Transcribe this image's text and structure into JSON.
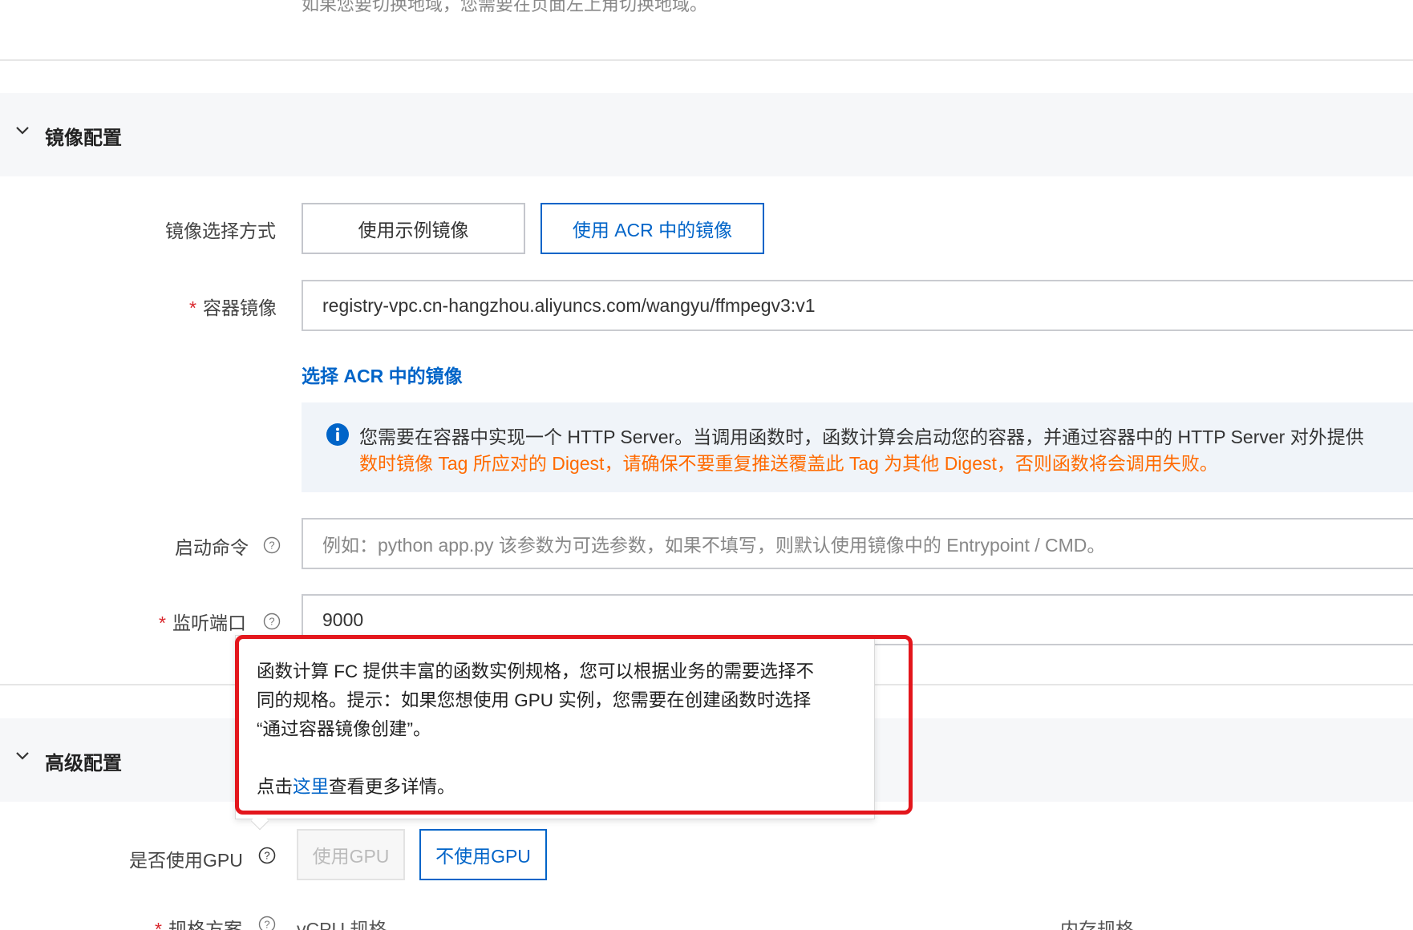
{
  "top_hint": "如果您要切换地域，您需要在页面左上角切换地域。",
  "image_section": {
    "title": "镜像配置",
    "select_method_label": "镜像选择方式",
    "method_options": [
      "使用示例镜像",
      "使用 ACR 中的镜像"
    ],
    "selected_method": "使用 ACR 中的镜像",
    "container_image_label": "容器镜像",
    "container_image_value": "registry-vpc.cn-hangzhou.aliyuncs.com/wangyu/ffmpegv3:v1",
    "select_acr_link": "选择 ACR 中的镜像",
    "alert_line1": "您需要在容器中实现一个 HTTP Server。当调用函数时，函数计算会启动您的容器，并通过容器中的 HTTP Server 对外提供",
    "alert_line2": "数时镜像 Tag 所应对的 Digest，请确保不要重复推送覆盖此 Tag 为其他 Digest，否则函数将会调用失败。",
    "startup_cmd_label": "启动命令",
    "startup_cmd_placeholder": "例如：python app.py 该参数为可选参数，如果不填写，则默认使用镜像中的 Entrypoint / CMD。",
    "listen_port_label": "监听端口",
    "listen_port_value": "9000"
  },
  "advanced_section": {
    "title": "高级配置",
    "gpu_label": "是否使用GPU",
    "gpu_options": [
      "使用GPU",
      "不使用GPU"
    ],
    "selected_gpu": "不使用GPU",
    "spec_label": "规格方案",
    "spec_columns": [
      "vCPU 规格",
      "内存规格"
    ]
  },
  "tooltip": {
    "line1": "函数计算 FC 提供丰富的函数实例规格，您可以根据业务的需要选择不",
    "line2": "同的规格。提示：如果您想使用 GPU 实例，您需要在创建函数时选择",
    "line3": "“通过容器镜像创建”。",
    "line4_prefix": "点击",
    "line4_link": "这里",
    "line4_suffix": "查看更多详情。"
  },
  "colors": {
    "primary": "#0064c8",
    "required": "#d9262c",
    "warning_text": "#ff6a00",
    "annotation": "#e3161c"
  },
  "required_mark": "*"
}
